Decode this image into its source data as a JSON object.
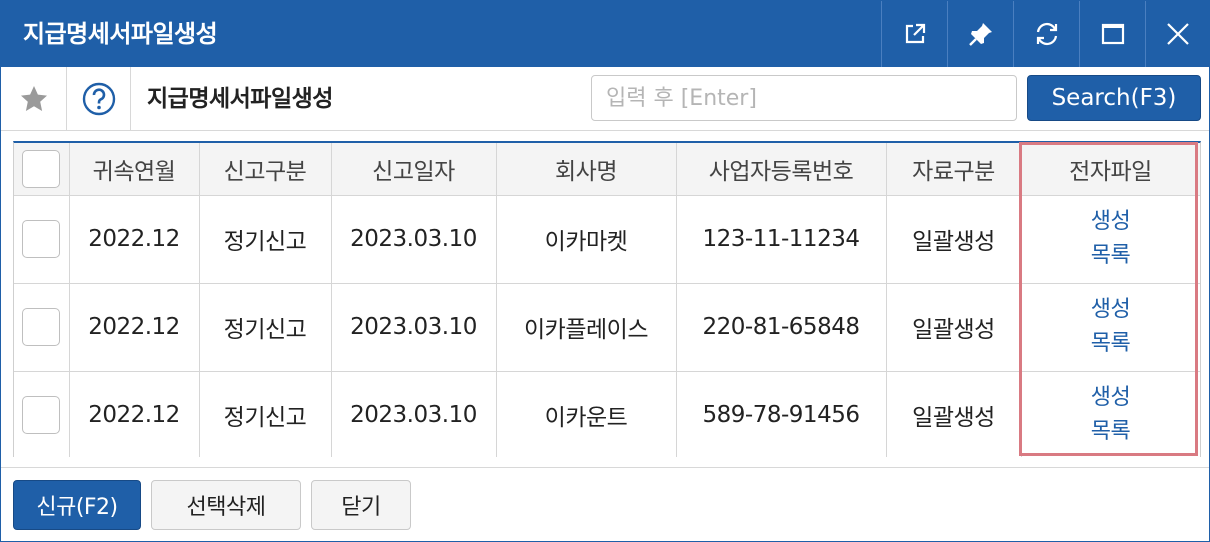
{
  "window": {
    "title": "지급명세서파일생성"
  },
  "toolbar": {
    "title": "지급명세서파일생성",
    "search_placeholder": "입력 후 [Enter]",
    "search_value": "",
    "search_button": "Search(F3)"
  },
  "grid": {
    "columns": [
      "귀속연월",
      "신고구분",
      "신고일자",
      "회사명",
      "사업자등록번호",
      "자료구분",
      "전자파일"
    ],
    "rows": [
      {
        "period": "2022.12",
        "report_type": "정기신고",
        "report_date": "2023.03.10",
        "company": "이카마켓",
        "biz_no": "123-11-11234",
        "data_type": "일괄생성",
        "file_create": "생성",
        "file_list": "목록"
      },
      {
        "period": "2022.12",
        "report_type": "정기신고",
        "report_date": "2023.03.10",
        "company": "이카플레이스",
        "biz_no": "220-81-65848",
        "data_type": "일괄생성",
        "file_create": "생성",
        "file_list": "목록"
      },
      {
        "period": "2022.12",
        "report_type": "정기신고",
        "report_date": "2023.03.10",
        "company": "이카운트",
        "biz_no": "589-78-91456",
        "data_type": "일괄생성",
        "file_create": "생성",
        "file_list": "목록"
      }
    ]
  },
  "footer": {
    "new_button": "신규(F2)",
    "delete_button": "선택삭제",
    "close_button": "닫기"
  },
  "colors": {
    "brand": "#1f5fa8",
    "highlight": "#d97a82",
    "link": "#1f5fa8"
  }
}
